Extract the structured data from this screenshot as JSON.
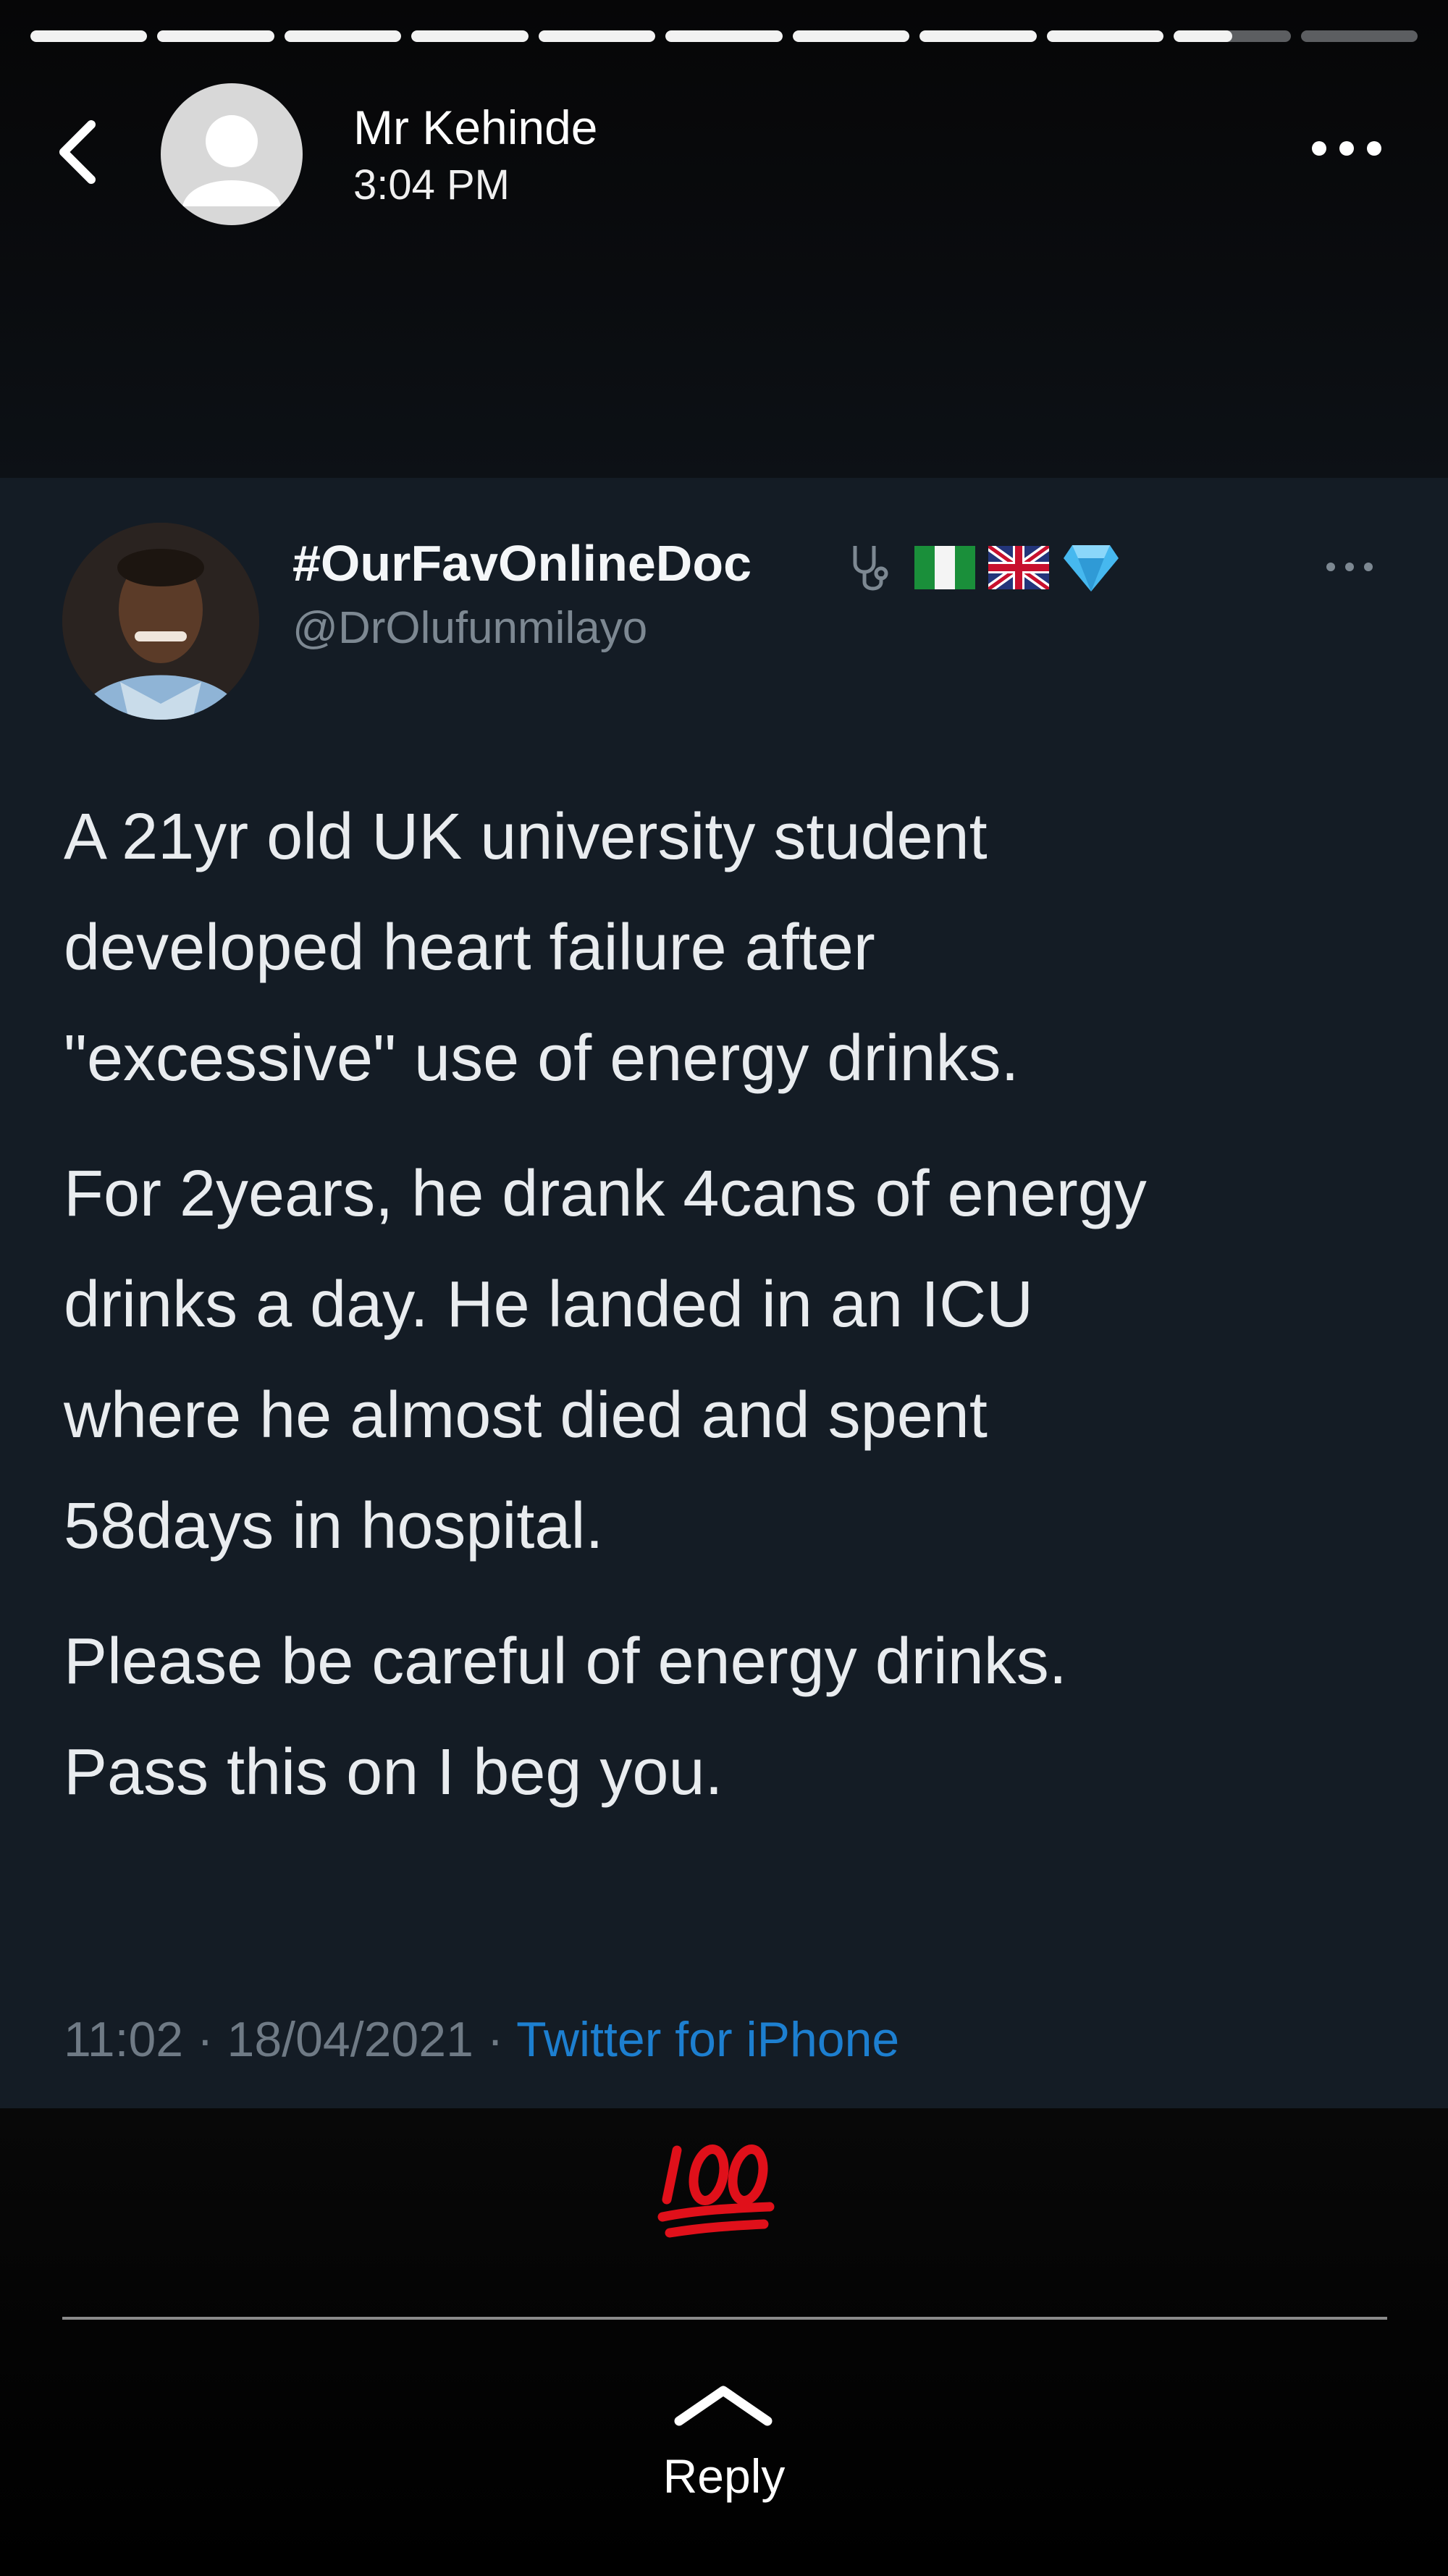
{
  "story": {
    "progress_segments": [
      1,
      1,
      1,
      1,
      1,
      1,
      1,
      1,
      1,
      0.5,
      0
    ],
    "poster_name": "Mr Kehinde",
    "poster_time": "3:04 PM"
  },
  "tweet": {
    "display_name": "#OurFavOnlineDoc",
    "handle": "@DrOlufunmilayo",
    "paragraphs": [
      [
        "A 21yr old UK university student",
        "developed heart failure after",
        "\"excessive\" use of energy drinks."
      ],
      [
        "For 2years, he drank 4cans of energy",
        "drinks a day. He landed in an ICU",
        "where he almost died and spent",
        "58days in hospital."
      ],
      [
        "Please be careful of energy drinks.",
        "Pass this on I beg you."
      ]
    ],
    "timestamp": "11:02 · 18/04/2021 · ",
    "source": "Twitter for iPhone"
  },
  "caption": {
    "emoji": "100-points-emoji"
  },
  "reply": {
    "label": "Reply"
  },
  "colors": {
    "tweet_bg": "#141c25",
    "link_blue": "#1d7fd0",
    "hundred_red": "#e0101a"
  }
}
